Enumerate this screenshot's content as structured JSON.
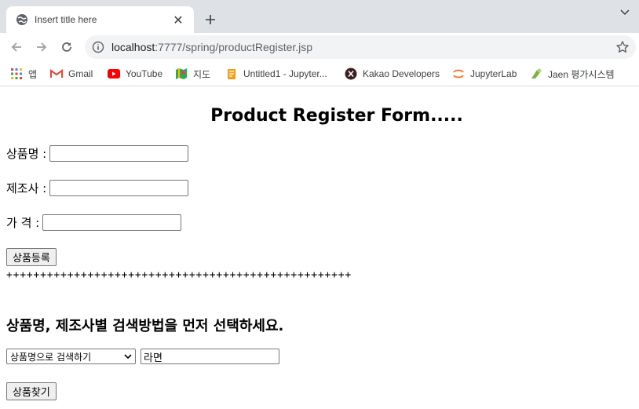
{
  "browser": {
    "tab": {
      "title": "Insert title here",
      "favicon": "globe-icon",
      "close": "✕"
    },
    "new_tab": "+",
    "url_host": "localhost",
    "url_path": ":7777/spring/productRegister.jsp"
  },
  "bookmarks": [
    {
      "label": "앱",
      "icon": "apps-grid-icon"
    },
    {
      "label": "Gmail",
      "icon": "gmail-icon"
    },
    {
      "label": "YouTube",
      "icon": "youtube-icon"
    },
    {
      "label": "지도",
      "icon": "maps-icon"
    },
    {
      "label": "Untitled1 - Jupyter...",
      "icon": "notebook-icon"
    },
    {
      "label": "Kakao Developers",
      "icon": "kakao-icon"
    },
    {
      "label": "JupyterLab",
      "icon": "jupyter-icon"
    },
    {
      "label": "Jaen 평가시스템",
      "icon": "jaen-icon"
    }
  ],
  "form": {
    "title": "Product Register Form.....",
    "fields": [
      {
        "label": "상품명 :",
        "value": ""
      },
      {
        "label": "제조사 :",
        "value": ""
      },
      {
        "label": "가 격 :",
        "value": ""
      }
    ],
    "submit_label": "상품등록",
    "divider": "+++++++++++++++++++++++++++++++++++++++++++++++++++"
  },
  "search": {
    "heading": "상품명, 제조사별 검색방법을 먼저 선택하세요.",
    "select_value": "상품명으로 검색하기",
    "keyword_value": "라면",
    "button_label": "상품찾기"
  },
  "colors": {
    "tabstrip": "#dee1e6",
    "omnibox": "#f1f3f4",
    "youtube": "#ff0000",
    "gmail": "#ea4335"
  }
}
